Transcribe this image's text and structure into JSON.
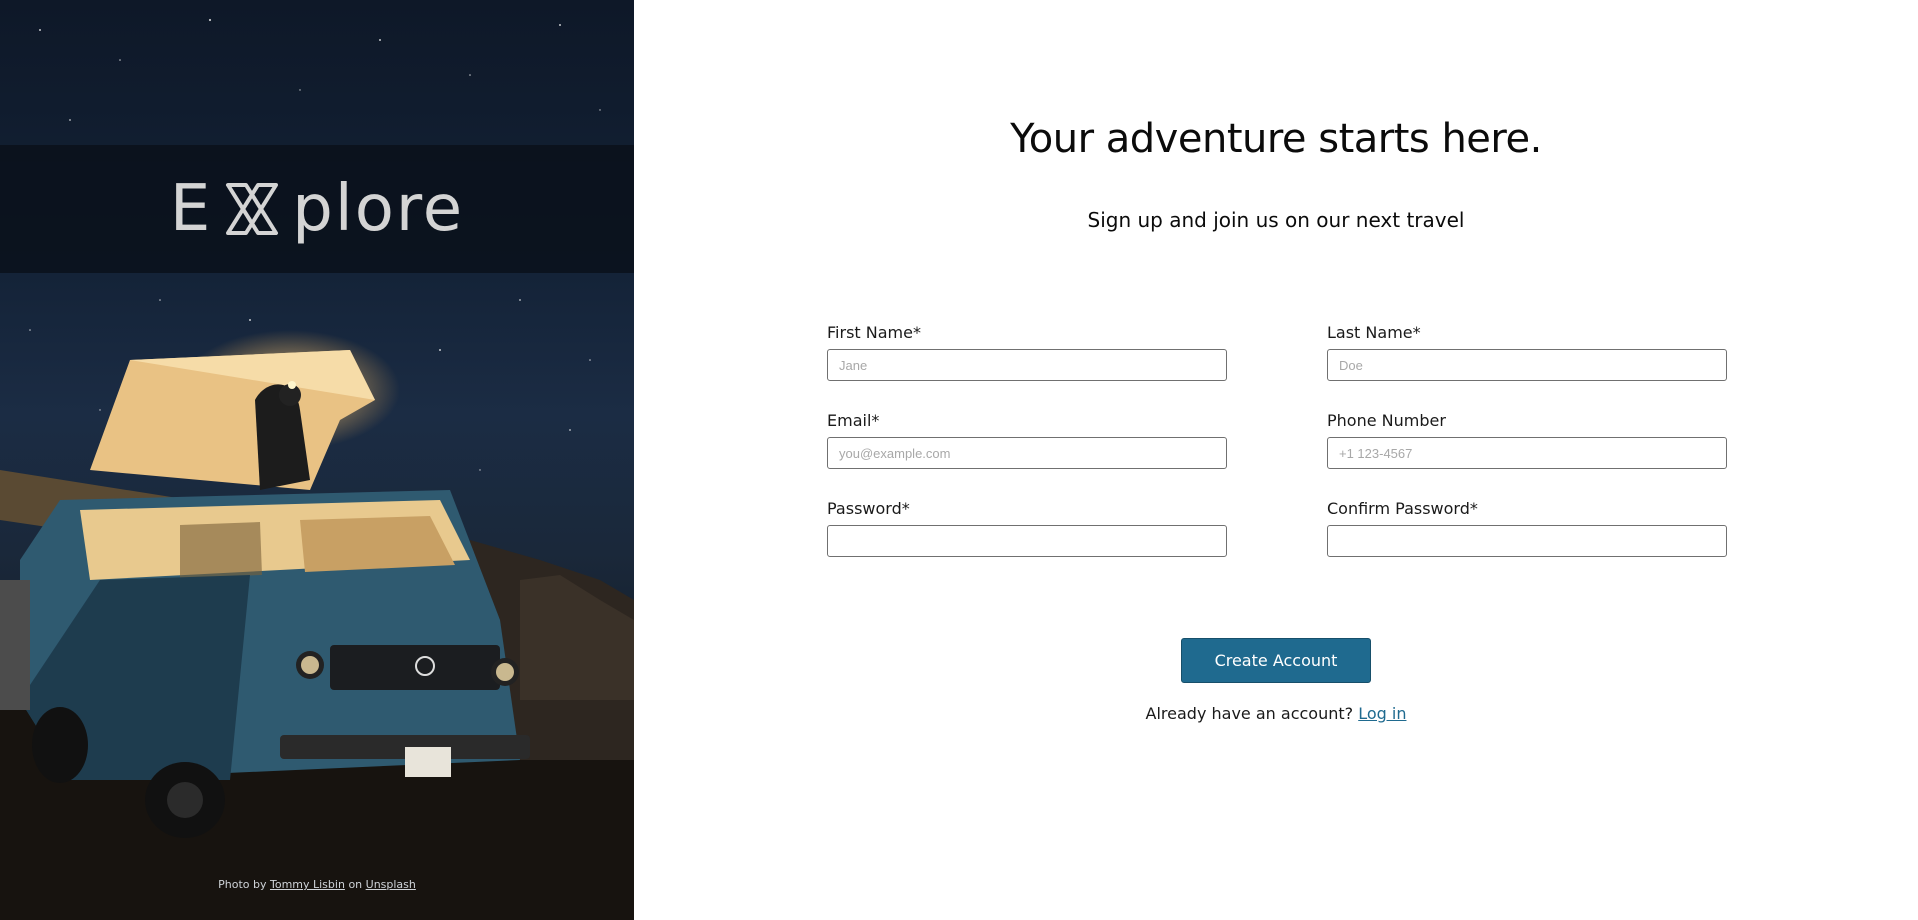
{
  "hero": {
    "logo": {
      "letter_e": "E",
      "rest": "plore"
    },
    "credit": {
      "prefix": "Photo by",
      "author": "Tommy Lisbin",
      "middle": "on",
      "site": "Unsplash"
    }
  },
  "form": {
    "title": "Your adventure starts here.",
    "subtitle": "Sign up and join us on our next travel",
    "fields": {
      "first_name": {
        "label": "First Name*",
        "placeholder": "Jane",
        "value": ""
      },
      "last_name": {
        "label": "Last Name*",
        "placeholder": "Doe",
        "value": ""
      },
      "email": {
        "label": "Email*",
        "placeholder": "you@example.com",
        "value": ""
      },
      "phone": {
        "label": "Phone Number",
        "placeholder": "+1 123-4567",
        "value": ""
      },
      "password": {
        "label": "Password*",
        "placeholder": "",
        "value": ""
      },
      "confirm_password": {
        "label": "Confirm Password*",
        "placeholder": "",
        "value": ""
      }
    },
    "submit_label": "Create Account",
    "login_prompt": "Already have an account?",
    "login_link": "Log in"
  },
  "colors": {
    "accent": "#1f6a8f",
    "hero_bg": "#142338"
  }
}
